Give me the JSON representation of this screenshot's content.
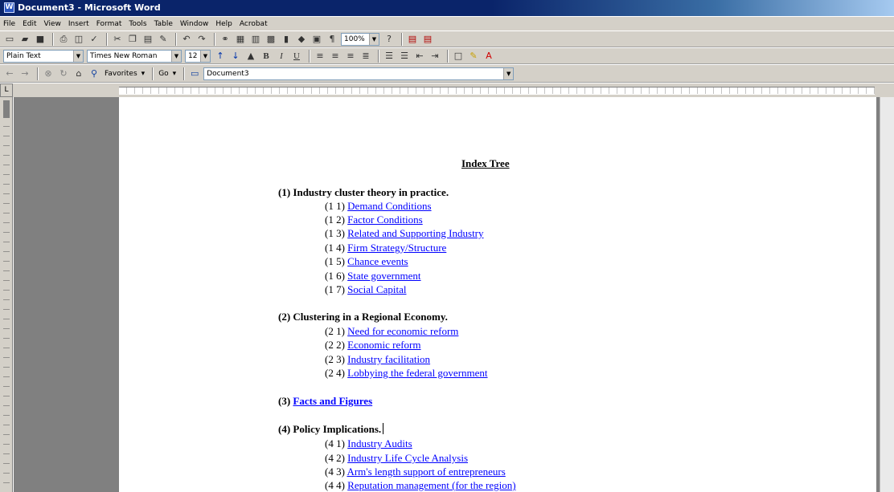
{
  "window": {
    "title": "Document3 - Microsoft Word"
  },
  "menu": [
    "File",
    "Edit",
    "View",
    "Insert",
    "Format",
    "Tools",
    "Table",
    "Window",
    "Help",
    "Acrobat"
  ],
  "standard_toolbar": {
    "zoom": "100%"
  },
  "formatting_toolbar": {
    "style": "Plain Text",
    "font": "Times New Roman",
    "size": "12"
  },
  "web_toolbar": {
    "favorites": "Favorites",
    "go": "Go",
    "address": "Document3"
  },
  "document": {
    "title": "Index Tree",
    "sections": [
      {
        "heading": "(1) Industry cluster theory in practice.",
        "items": [
          {
            "num": "(1 1)",
            "text": "Demand Conditions"
          },
          {
            "num": "(1 2)",
            "text": "Factor Conditions"
          },
          {
            "num": "(1 3)",
            "text": "Related and Supporting Industry"
          },
          {
            "num": "(1 4)",
            "text": "Firm Strategy/Structure"
          },
          {
            "num": "(1 5)",
            "text": "Chance events"
          },
          {
            "num": "(1 6)",
            "text": "State government"
          },
          {
            "num": "(1 7)",
            "text": "Social Capital"
          }
        ]
      },
      {
        "heading": "(2) Clustering in a Regional Economy.",
        "items": [
          {
            "num": "(2 1)",
            "text": "Need for economic reform"
          },
          {
            "num": "(2 2)",
            "text": "Economic reform"
          },
          {
            "num": "(2 3)",
            "text": "Industry facilitation"
          },
          {
            "num": "(2 4)",
            "text": "Lobbying the federal government"
          }
        ]
      },
      {
        "heading_num": "(3)",
        "heading_link": "Facts and Figures",
        "items": []
      },
      {
        "heading": "(4) Policy Implications.",
        "items": [
          {
            "num": "(4 1)",
            "text": "Industry Audits"
          },
          {
            "num": "(4 2)",
            "text": "Industry Life Cycle Analysis"
          },
          {
            "num": "(4 3)",
            "text": "Arm's length support of entrepreneurs"
          },
          {
            "num": "(4 4)",
            "text": "Reputation management (for the region)"
          }
        ]
      }
    ]
  }
}
